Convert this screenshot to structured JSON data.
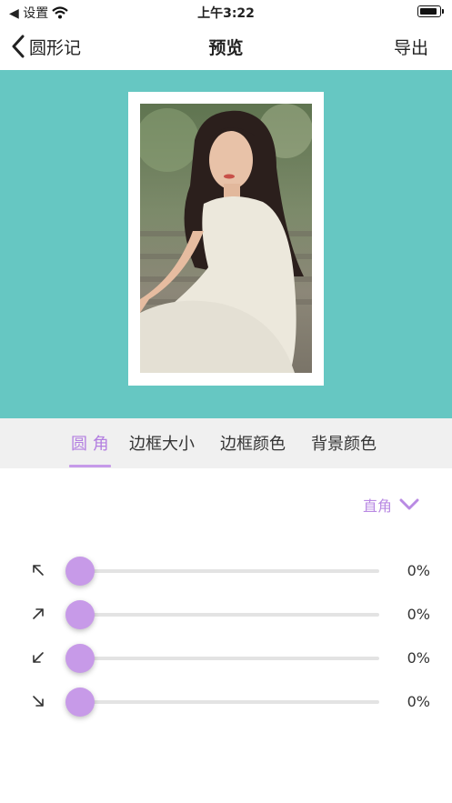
{
  "status_bar": {
    "carrier": "◀ 设置",
    "time": "上午3:22"
  },
  "nav": {
    "back_label": "圆形记",
    "title": "预览",
    "export_label": "导出"
  },
  "tabs": [
    {
      "label": "圆 角",
      "active": true
    },
    {
      "label": "边框大小",
      "active": false
    },
    {
      "label": "边框颜色",
      "active": false
    },
    {
      "label": "背景颜色",
      "active": false
    }
  ],
  "corner_type": {
    "label": "直角",
    "icon": "chevron-down-icon"
  },
  "sliders": [
    {
      "icon": "arrow-up-left-icon",
      "value": 0,
      "display": "0%"
    },
    {
      "icon": "arrow-up-right-icon",
      "value": 0,
      "display": "0%"
    },
    {
      "icon": "arrow-down-left-icon",
      "value": 0,
      "display": "0%"
    },
    {
      "icon": "arrow-down-right-icon",
      "value": 0,
      "display": "0%"
    }
  ],
  "colors": {
    "preview_bg": "#66c7c2",
    "accent": "#c79ae8",
    "active_tab": "#b37fe0"
  }
}
